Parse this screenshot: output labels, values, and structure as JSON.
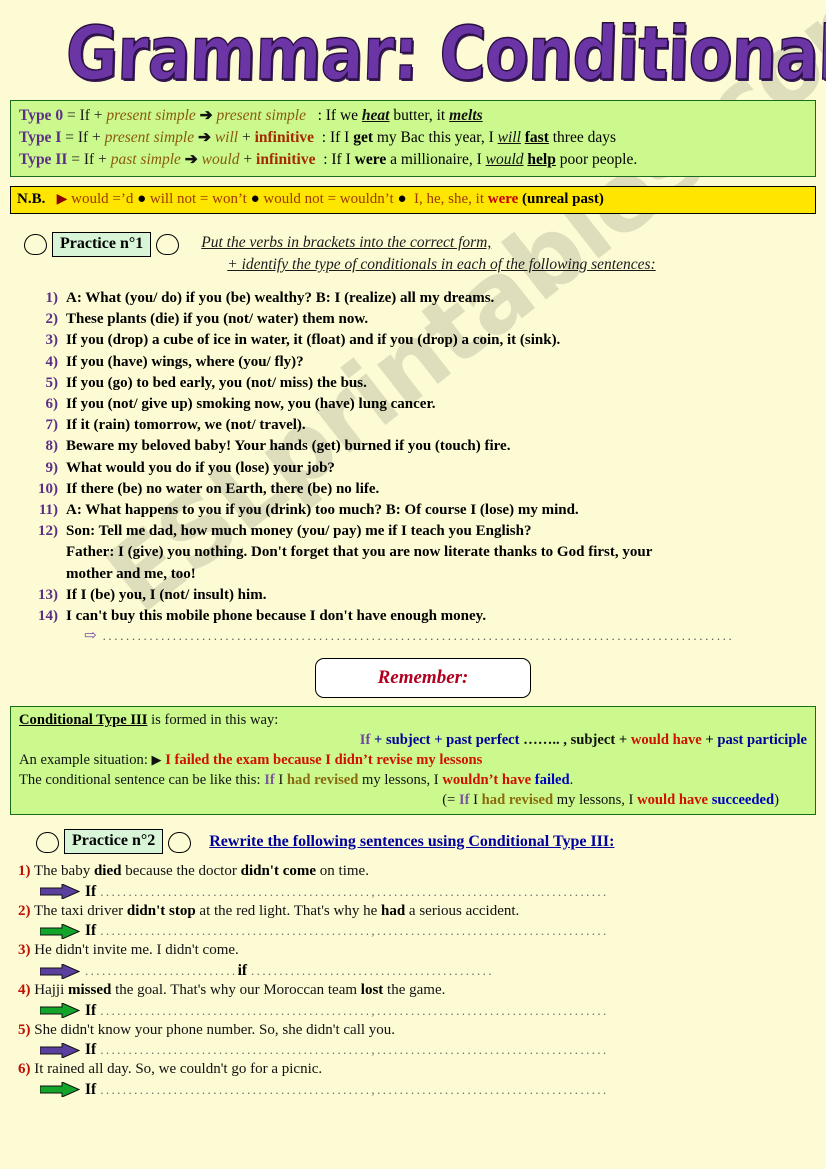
{
  "title": "Grammar: Conditionals",
  "watermark": "ESLprintables.com",
  "rules": {
    "rows": [
      {
        "type": "Type 0",
        "eq": " = If + ",
        "tense1": "present simple",
        "arrow": "➔",
        "tense2": "present simple",
        "colon": ": If we ",
        "ex_bold1": "heat",
        "ex_mid": " butter, it ",
        "ex_bold2": "melts",
        "ex_tail": ""
      },
      {
        "type": "Type I",
        "eq": " = If + ",
        "tense1": "present simple",
        "arrow": "➔",
        "tense2": "will",
        "plus": " + ",
        "infinitive": "infinitive",
        "colon": ": If I ",
        "ex_bold1": "get",
        "ex_mid": " my Bac this year, I ",
        "ex_italic": "will",
        "ex_bold2": "fast",
        "ex_tail": " three days"
      },
      {
        "type": "Type II",
        "eq": " = If + ",
        "tense1": "past simple",
        "arrow": "➔",
        "tense2": "would",
        "plus": " + ",
        "infinitive": "infinitive",
        "colon": ": If I ",
        "ex_bold1": "were",
        "ex_mid": " a millionaire, I ",
        "ex_italic": "would",
        "ex_bold2": "help",
        "ex_tail": " poor people."
      }
    ]
  },
  "nb": {
    "label": "N.B.",
    "triangle": "▶",
    "item1": "would =’d",
    "bullet": "●",
    "item2": "will not = won’t",
    "item3": "would not = wouldn’t",
    "item4_pre": "I, he, she, it ",
    "item4_bold": "were",
    "item4_paren": "(unreal past)"
  },
  "practice1": {
    "badge": "Practice n°1",
    "instr_line1": "Put the verbs in brackets into the correct form,",
    "instr_line2": "+ identify the type of conditionals in each of the following sentences:",
    "items": [
      {
        "num": "1)",
        "text": "A: What (you/ do) if you (be) wealthy?  B: I (realize) all my dreams."
      },
      {
        "num": "2)",
        "text": "These plants (die) if you (not/ water) them now."
      },
      {
        "num": "3)",
        "text": "If you (drop) a cube of ice in water, it (float) and if you (drop) a coin, it (sink)."
      },
      {
        "num": "4)",
        "text": "If you (have) wings, where (you/ fly)?"
      },
      {
        "num": "5)",
        "text": "If you (go) to bed early, you (not/ miss) the bus."
      },
      {
        "num": "6)",
        "text": "If you (not/ give up) smoking now, you (have) lung cancer."
      },
      {
        "num": "7)",
        "text": "If it (rain) tomorrow, we (not/ travel)."
      },
      {
        "num": "8)",
        "text": "Beware my beloved baby! Your hands (get) burned if you (touch) fire."
      },
      {
        "num": "9)",
        "text": "What would you do if you (lose) your job?"
      },
      {
        "num": "10)",
        "text": "If there (be) no water on Earth, there (be) no life."
      },
      {
        "num": "11)",
        "text": "A: What happens to you if you (drink) too much?   B: Of course I (lose) my mind."
      },
      {
        "num": "12)",
        "text": "Son: Tell me dad, how much money (you/ pay) me if I teach you English?"
      },
      {
        "num": "",
        "text": "Father: I (give) you nothing. Don't forget that you are now literate thanks to God first, your"
      },
      {
        "num": "",
        "text": "mother and me, too!"
      },
      {
        "num": "13)",
        "text": "If I (be) you, I (not/ insult) him."
      },
      {
        "num": "14)",
        "text": "I can't buy this mobile phone because I don't have enough money."
      }
    ],
    "answer_arrow": "⇨",
    "answer_dots": "............................................................................................................"
  },
  "remember": {
    "label": "Remember:"
  },
  "type3": {
    "line1_head": "Conditional Type III",
    "line1_rest": " is formed in this way:",
    "formula": {
      "if": "If",
      "plus1": " + subject + ",
      "past_perfect": "past perfect",
      "dots": " …….. , ",
      "subject2": "subject",
      "plus2": " + ",
      "would_have": "would have",
      "plus3": " + ",
      "past_participle": "past participle"
    },
    "example_label": "An example situation: ",
    "example_triangle": "▶",
    "example_text": "I failed the exam because I didn’t revise my lessons",
    "sentence_label": "The conditional sentence can be like this: ",
    "sentence": {
      "if": "If",
      "i": " I ",
      "had_revised": "had revised",
      "mid": " my lessons, I ",
      "wouldnt_have": "wouldn’t have",
      "sp": " ",
      "failed": "failed",
      "dot": "."
    },
    "alt": {
      "open": "(= ",
      "if": "If",
      "i": " I ",
      "had_revised": "had revised",
      "mid": " my lessons, I ",
      "would_have": "would have",
      "sp": " ",
      "succeeded": "succeeded",
      "close": ")"
    }
  },
  "practice2": {
    "badge": "Practice n°2",
    "instr": "Rewrite the following sentences using Conditional Type III:",
    "items": [
      {
        "num": "1)",
        "pre": "The baby ",
        "b1": "died",
        "mid": " because the doctor ",
        "b2": "didn't come",
        "post": " on time.",
        "arrow_color": "#5b3f9e",
        "if_label": "If",
        "dots1": "................................................,",
        "dots2": "........................................."
      },
      {
        "num": "2)",
        "pre": "The taxi driver ",
        "b1": "didn't stop",
        "mid": " at the red light. That's why he ",
        "b2": "had",
        "post": " a serious accident.",
        "arrow_color": "#13a52a",
        "if_label": "If",
        "dots1": "................................................,",
        "dots2": "........................................."
      },
      {
        "num": "3)",
        "pre": "He didn't invite me. I didn't come.",
        "b1": "",
        "mid": "",
        "b2": "",
        "post": "",
        "arrow_color": "#5b3f9e",
        "if_label": "if",
        "dots1": "...........................",
        "dots2": "...........................................",
        "if_center": true
      },
      {
        "num": "4)",
        "pre": "Hajji ",
        "b1": "missed",
        "mid": " the goal. That's why our Moroccan team ",
        "b2": "lost",
        "post": " the game.",
        "arrow_color": "#13a52a",
        "if_label": "If",
        "dots1": "................................................,",
        "dots2": "........................................."
      },
      {
        "num": "5)",
        "pre": "She didn't know your phone number. So, she didn't call you.",
        "b1": "",
        "mid": "",
        "b2": "",
        "post": "",
        "arrow_color": "#5b3f9e",
        "if_label": "If",
        "dots1": "................................................,",
        "dots2": "........................................."
      },
      {
        "num": "6)",
        "pre": "It rained all day. So, we couldn't go for a picnic.",
        "b1": "",
        "mid": "",
        "b2": "",
        "post": "",
        "arrow_color": "#13a52a",
        "if_label": "If",
        "dots1": "................................................,",
        "dots2": "........................................."
      }
    ]
  },
  "colors": {
    "page_bg": "#fcfbd4",
    "green_box": "#ccf98e",
    "yellow_box": "#ffe600",
    "title_purple": "#6B35A5",
    "badge_green": "#d8f5d8",
    "arrow_purple": "#5b3f9e",
    "arrow_green": "#13a52a"
  }
}
